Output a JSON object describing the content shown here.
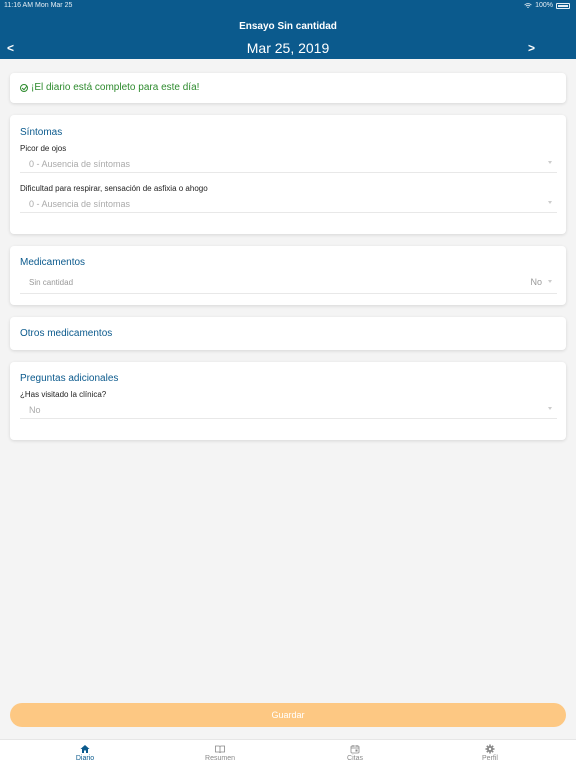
{
  "status_bar": {
    "time_date": "11:16 AM   Mon Mar 25",
    "battery": "100%"
  },
  "header": {
    "title": "Ensayo Sin cantidad",
    "date": "Mar 25, 2019",
    "prev_label": "<",
    "next_label": ">"
  },
  "banner": {
    "text": "¡El diario está completo para este día!"
  },
  "symptoms": {
    "title": "Síntomas",
    "fields": [
      {
        "label": "Picor de ojos",
        "value": "0 - Ausencia de síntomas"
      },
      {
        "label": "Dificultad para respirar, sensación de asfixia o ahogo",
        "value": "0 - Ausencia de síntomas"
      }
    ]
  },
  "medications": {
    "title": "Medicamentos",
    "row_label": "Sin cantidad",
    "row_value": "No"
  },
  "other_medications": {
    "title": "Otros medicamentos"
  },
  "additional": {
    "title": "Preguntas adicionales",
    "question": "¿Has visitado la clínica?",
    "value": "No"
  },
  "save_label": "Guardar",
  "tabs": [
    {
      "label": "Diario",
      "icon": "home-icon"
    },
    {
      "label": "Resumen",
      "icon": "book-icon"
    },
    {
      "label": "Citas",
      "icon": "calendar-icon"
    },
    {
      "label": "Perfil",
      "icon": "gear-icon"
    }
  ],
  "colors": {
    "header": "#0b5a8d",
    "success": "#2e8b2e",
    "save_button": "#fdc883"
  }
}
